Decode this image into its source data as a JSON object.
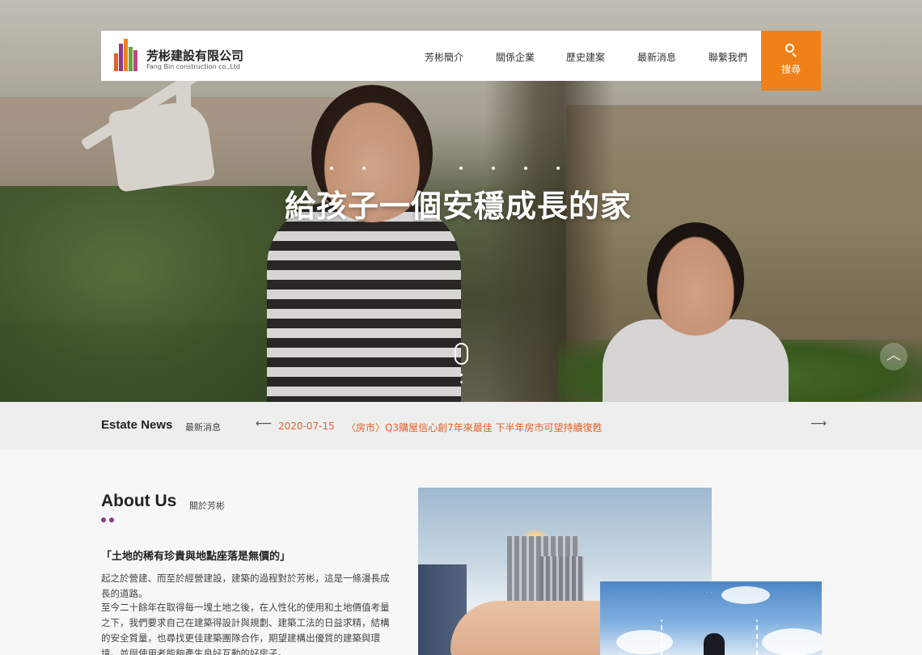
{
  "header": {
    "brand_cn": "芳彬建設有限公司",
    "brand_en": "Fang Bin construction co.,Ltd",
    "logo_colors": [
      "#e0612b",
      "#8d3b8e",
      "#f08119",
      "#6aa33a",
      "#b64a8c"
    ],
    "nav": [
      {
        "label": "芳彬簡介"
      },
      {
        "label": "關係企業"
      },
      {
        "label": "歷史建案"
      },
      {
        "label": "最新消息"
      },
      {
        "label": "聯繫我們"
      }
    ],
    "search_label": "搜尋",
    "search_icon": "search-icon",
    "accent": "#f08119"
  },
  "hero": {
    "title": "給孩子一個安穩成長的家",
    "scroll_icon": "mouse-scroll-icon",
    "back_top_icon": "chevron-up-icon"
  },
  "news": {
    "title": "Estate News",
    "subtitle": "最新消息",
    "prev_icon": "arrow-left-icon",
    "next_icon": "arrow-right-icon",
    "date": "2020-07-15",
    "headline": "〈房市〉Q3購屋信心創7年來最佳 下半年房市可望持續復甦",
    "color": "#e3622a"
  },
  "about": {
    "title": "About Us",
    "subtitle": "關於芳彬",
    "dot_color": "#8b3a8b",
    "quote": "「土地的稀有珍貴與地點座落是無價的」",
    "paragraphs": [
      "起之於營建、而至於經營建設，建築的過程對於芳彬，這是一條漫長成長的道路。",
      "至今二十餘年在取得每一塊土地之後，在人性化的使用和土地價值考量之下，我們要求自己在建築得設計與規劃、建築工法的日益求精，結構的安全質量，也尋找更佳建築團隊合作，期望建構出優質的建築與環境，並與使用者能夠產生良好互動的好房子。"
    ]
  }
}
